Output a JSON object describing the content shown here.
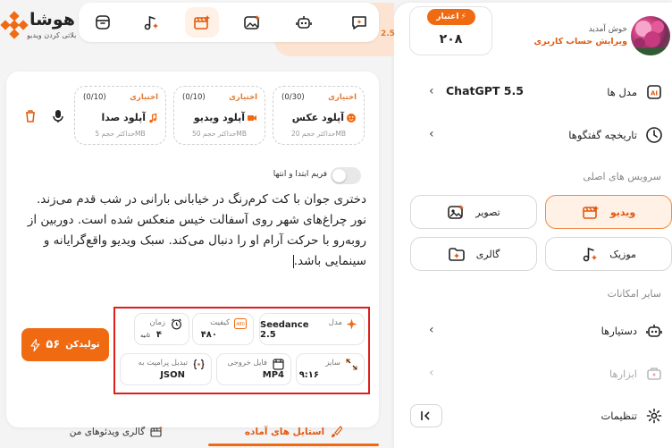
{
  "brand": {
    "name": "هوشا",
    "tagline": "بلاتی کردن ویدیو"
  },
  "credit": {
    "badge": "اعتبار",
    "value": "۲۰۸"
  },
  "user": {
    "welcome": "خوش آمدید",
    "edit": "ویرایش حساب کاربری"
  },
  "sidebar": {
    "models_label": "مدل ها",
    "model_name": "ChatGPT 5.5",
    "history_label": "تاریخچه گفتگوها",
    "main_services_title": "سرویس های اصلی",
    "services": [
      {
        "label": "ویدیو",
        "icon": "video-icon",
        "active": true
      },
      {
        "label": "تصویر",
        "icon": "image-icon",
        "active": false
      },
      {
        "label": "موزیک",
        "icon": "music-icon",
        "active": false
      },
      {
        "label": "گالری",
        "icon": "gallery-icon",
        "active": false
      }
    ],
    "other_title": "سایر امکانات",
    "assistants_label": "دستیارها",
    "tools_label": "ابزارها",
    "settings_label": "تنظیمات"
  },
  "top": {
    "model_pill": "2.5"
  },
  "uploads": [
    {
      "optional": "اختیاری",
      "count": "(0/30)",
      "title": "آپلود عکس",
      "max": "حداکثر حجم 20MB",
      "icon": "image-upload-icon"
    },
    {
      "optional": "اختیاری",
      "count": "(0/10)",
      "title": "آپلود ویدیو",
      "max": "حداکثر حجم 50MB",
      "icon": "video-upload-icon"
    },
    {
      "optional": "اختیاری",
      "count": "(0/10)",
      "title": "آپلود صدا",
      "max": "حداکثر حجم 5MB",
      "icon": "audio-upload-icon"
    }
  ],
  "frame_toggle": {
    "label": "فریم ابتدا و انتها",
    "on": false
  },
  "prompt": "دختری جوان با کت کرم‌رنگ در خیابانی بارانی در شب قدم می‌زند. نور چراغ‌های شهر روی آسفالت خیس منعکس شده است. دوربین از روبه‌رو با حرکت آرام او را دنبال می‌کند. سبک ویدیو واقع‌گرایانه و سینمایی باشد.",
  "settings": {
    "model": {
      "label": "مدل",
      "value": "Seedance 2.5"
    },
    "quality": {
      "label": "کیفیت",
      "value": "۴۸۰"
    },
    "duration": {
      "label": "زمان",
      "value": "۴",
      "unit": "ثانیه"
    },
    "size": {
      "label": "سایز",
      "value": "۹:۱۶"
    },
    "output": {
      "label": "فایل خروجی",
      "value": "MP4"
    },
    "json": {
      "label": "تبدیل پرامپت به",
      "value": "JSON"
    }
  },
  "generate": {
    "label": "تولیدکن",
    "cost": "۵۶"
  },
  "bottom_tabs": {
    "styles": "استایل های آماده",
    "gallery": "گالری ویدئوهای من"
  },
  "colors": {
    "accent": "#f06a12",
    "accent_soft": "#fff1e6",
    "highlight": "#e01d1d"
  }
}
